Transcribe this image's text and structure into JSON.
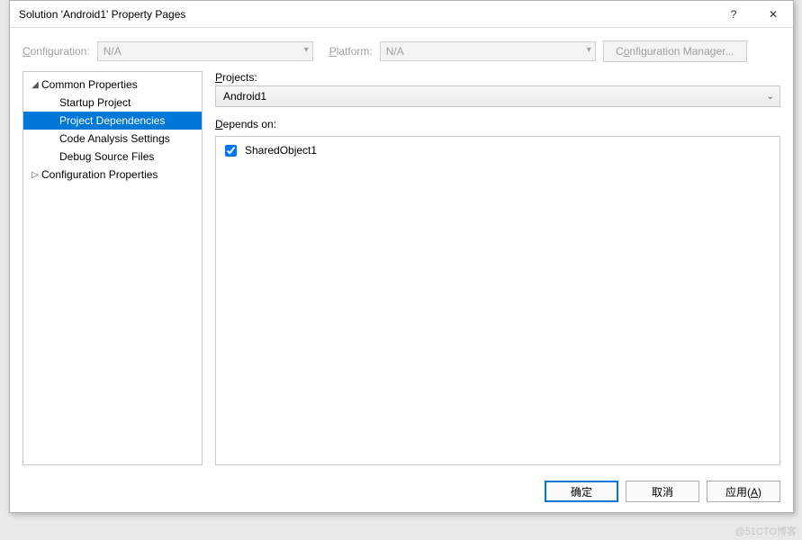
{
  "titlebar": {
    "title": "Solution 'Android1' Property Pages",
    "help_glyph": "?",
    "close_glyph": "✕"
  },
  "config_row": {
    "configuration_label": "Configuration:",
    "configuration_value": "N/A",
    "platform_label": "Platform:",
    "platform_value": "N/A",
    "manager_label": "Configuration Manager..."
  },
  "tree": {
    "items": [
      {
        "label": "Common Properties",
        "level": 1,
        "expanded": true,
        "selected": false
      },
      {
        "label": "Startup Project",
        "level": 2,
        "expanded": null,
        "selected": false
      },
      {
        "label": "Project Dependencies",
        "level": 2,
        "expanded": null,
        "selected": true
      },
      {
        "label": "Code Analysis Settings",
        "level": 2,
        "expanded": null,
        "selected": false
      },
      {
        "label": "Debug Source Files",
        "level": 2,
        "expanded": null,
        "selected": false
      },
      {
        "label": "Configuration Properties",
        "level": 1,
        "expanded": false,
        "selected": false
      }
    ]
  },
  "right": {
    "projects_label": "Projects:",
    "selected_project": "Android1",
    "depends_label": "Depends on:",
    "dependencies": [
      {
        "name": "SharedObject1",
        "checked": true
      }
    ]
  },
  "footer": {
    "ok": "确定",
    "cancel": "取消",
    "apply": "应用(A)"
  },
  "watermark": "@51CTO博客"
}
